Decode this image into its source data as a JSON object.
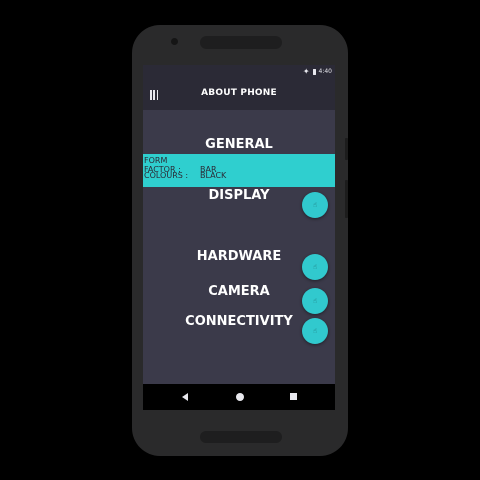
{
  "status_bar": {
    "time": "4:40",
    "wifi_icon": "wifi-icon",
    "battery_icon": "battery-icon"
  },
  "toolbar": {
    "title": "ABOUT PHONE",
    "menu_icon": "menu-icon"
  },
  "sections": {
    "general": "GENERAL",
    "display": "DISPLAY",
    "hardware": "HARDWARE",
    "camera": "CAMERA",
    "connectivity": "CONNECTIVITY"
  },
  "general_info": {
    "rows": [
      {
        "label": "FORM FACTOR :",
        "value": "BAR"
      },
      {
        "label": "COLOURS :",
        "value": "BLACK"
      }
    ]
  },
  "fab_icon": "touch-icon",
  "colors": {
    "screen_bg": "#3b3a4a",
    "toolbar_bg": "#2b2a36",
    "accent": "#2fcfcf"
  },
  "navigation": {
    "back": "back-icon",
    "home": "home-icon",
    "recent": "recent-apps-icon"
  }
}
